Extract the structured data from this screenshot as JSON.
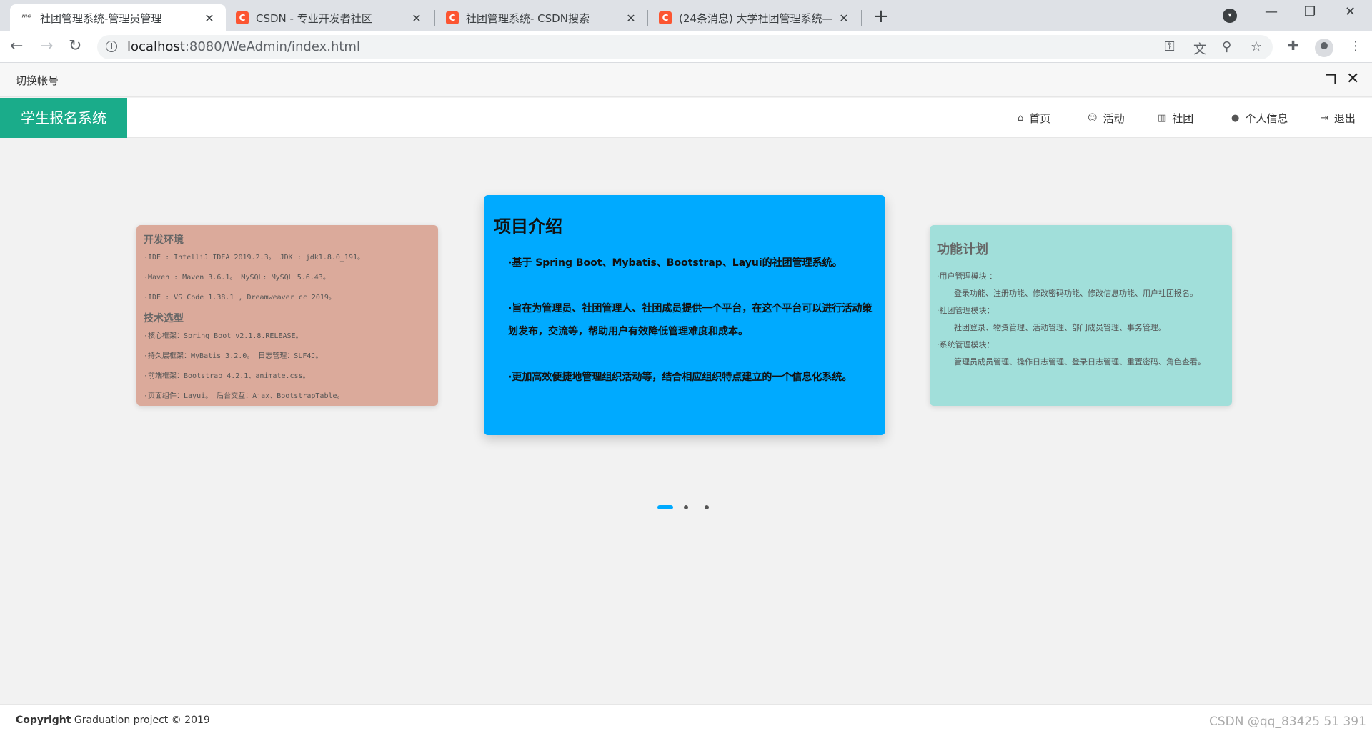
{
  "browser": {
    "tabs": [
      {
        "title": "社团管理系统-管理员管理",
        "favicon": "ws"
      },
      {
        "title": "CSDN - 专业开发者社区",
        "favicon": "C"
      },
      {
        "title": "社团管理系统- CSDN搜索",
        "favicon": "C"
      },
      {
        "title": "(24条消息) 大学社团管理系统—",
        "favicon": "C"
      }
    ],
    "url_host": "localhost",
    "url_rest": ":8080/WeAdmin/index.html"
  },
  "switchbar": {
    "label": "切换帐号"
  },
  "app": {
    "logo": "学生报名系统",
    "nav": [
      {
        "icon": "home-icon",
        "label": "首页"
      },
      {
        "icon": "smile-icon",
        "label": "活动"
      },
      {
        "icon": "bar-chart-icon",
        "label": "社团"
      },
      {
        "icon": "user-icon",
        "label": "个人信息"
      },
      {
        "icon": "sign-out-icon",
        "label": "退出"
      }
    ]
  },
  "cards": {
    "left": {
      "heading1": "开发环境",
      "env": [
        "·IDE : IntelliJ IDEA 2019.2.3。 JDK : jdk1.8.0_191。",
        "·Maven : Maven 3.6.1。 MySQL: MySQL 5.6.43。",
        "·IDE : VS Code 1.38.1 , Dreamweaver cc 2019。"
      ],
      "heading2": "技术选型",
      "tech": [
        "·核心框架：Spring Boot v2.1.8.RELEASE。",
        "·持久层框架：MyBatis 3.2.0。 日志管理：SLF4J。",
        "·前端框架：Bootstrap 4.2.1、animate.css。",
        "·页面组件：Layui。          后台交互：Ajax、BootstrapTable。"
      ]
    },
    "center": {
      "title": "项目介绍",
      "items": [
        "·基于 Spring Boot、Mybatis、Bootstrap、Layui的社团管理系统。",
        "·旨在为管理员、社团管理人、社团成员提供一个平台，在这个平台可以进行活动策划发布，交流等，帮助用户有效降低管理难度和成本。",
        "·更加高效便捷地管理组织活动等，结合相应组织特点建立的一个信息化系统。"
      ]
    },
    "right": {
      "title": "功能计划",
      "lines": [
        "·用户管理模块 ：",
        "登录功能、注册功能、修改密码功能、修改信息功能、用户社团报名。",
        "·社团管理模块：",
        "社团登录、物资管理、活动管理、部门成员管理、事务管理。",
        "·系统管理模块：",
        "管理员成员管理、操作日志管理、登录日志管理、重置密码、角色查看。"
      ]
    }
  },
  "carousel": {
    "active_index": 0,
    "count": 3
  },
  "footer": {
    "copyright_bold": "Copyright",
    "copyright_rest": " Graduation project © 2019",
    "watermark": "CSDN @qq_83425 51 391"
  }
}
